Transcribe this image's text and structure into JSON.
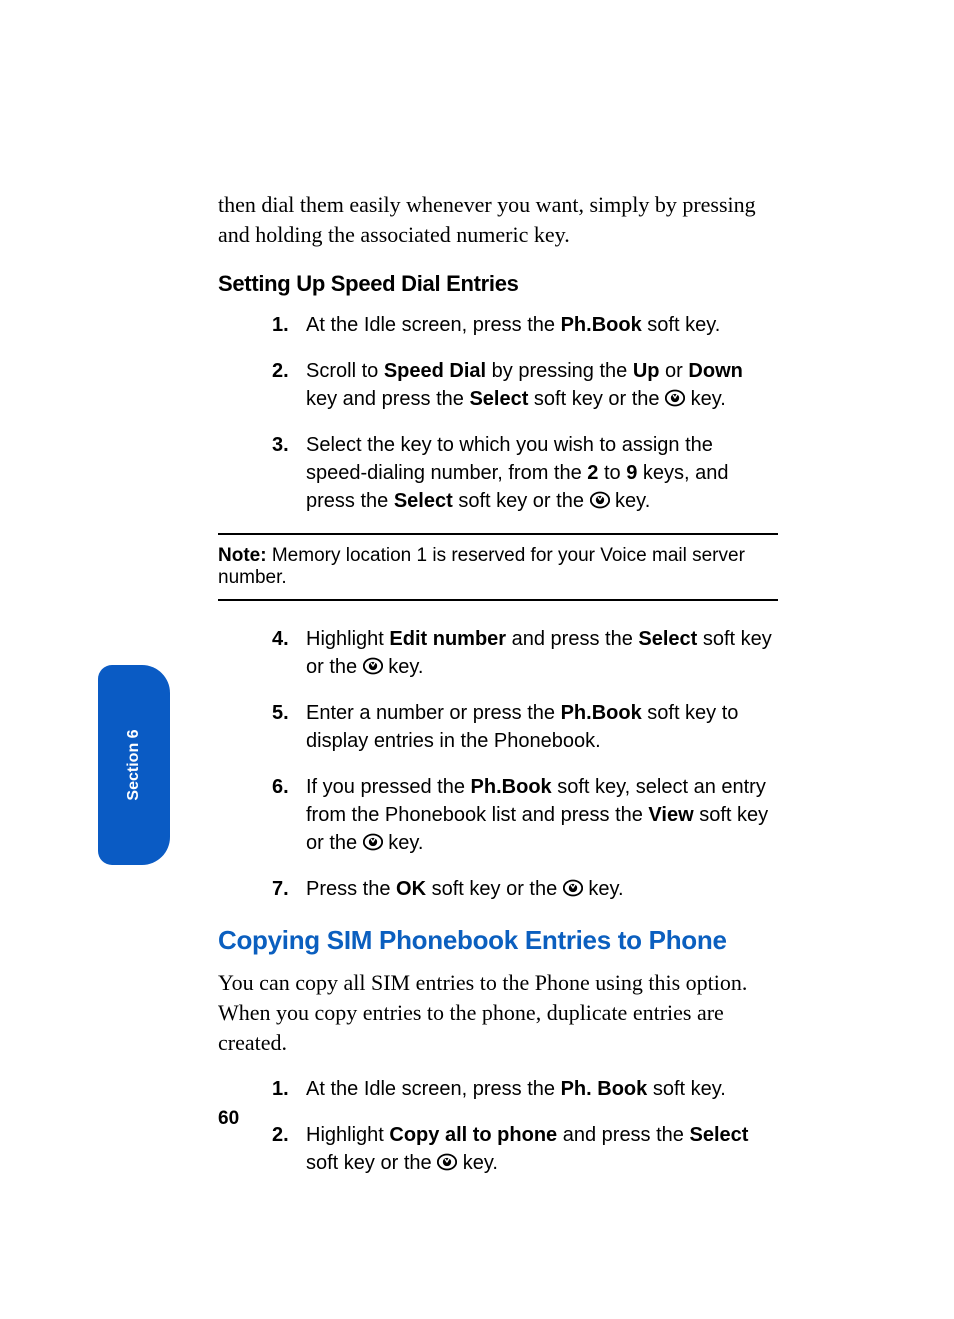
{
  "tab": {
    "label": "Section 6"
  },
  "page_number": "60",
  "intro": "then dial them easily whenever you want, simply by pressing and holding the associated numeric key.",
  "section_a": {
    "heading": "Setting Up Speed Dial Entries",
    "steps_first": [
      {
        "num": "1.",
        "parts": [
          {
            "t": "At the Idle screen, press the "
          },
          {
            "t": "Ph.Book",
            "b": true
          },
          {
            "t": " soft key."
          }
        ]
      },
      {
        "num": "2.",
        "parts": [
          {
            "t": "Scroll to "
          },
          {
            "t": "Speed Dial",
            "b": true
          },
          {
            "t": " by pressing the "
          },
          {
            "t": "Up",
            "b": true
          },
          {
            "t": " or "
          },
          {
            "t": "Down",
            "b": true
          },
          {
            "t": " key and press the "
          },
          {
            "t": "Select",
            "b": true
          },
          {
            "t": " soft key or the "
          },
          {
            "icon": true
          },
          {
            "t": " key."
          }
        ]
      },
      {
        "num": "3.",
        "parts": [
          {
            "t": "Select the key to which you wish to assign the speed-dialing number, from the "
          },
          {
            "t": "2",
            "b": true
          },
          {
            "t": " to "
          },
          {
            "t": "9",
            "b": true
          },
          {
            "t": " keys, and press the "
          },
          {
            "t": "Select",
            "b": true
          },
          {
            "t": " soft key or the "
          },
          {
            "icon": true
          },
          {
            "t": " key."
          }
        ]
      }
    ],
    "note_label": "Note:",
    "note_text": " Memory location 1 is reserved for your Voice mail server number.",
    "steps_second": [
      {
        "num": "4.",
        "parts": [
          {
            "t": "Highlight "
          },
          {
            "t": "Edit number",
            "b": true
          },
          {
            "t": " and press the "
          },
          {
            "t": "Select",
            "b": true
          },
          {
            "t": " soft key or the "
          },
          {
            "icon": true
          },
          {
            "t": " key."
          }
        ]
      },
      {
        "num": "5.",
        "parts": [
          {
            "t": "Enter a number or press the "
          },
          {
            "t": "Ph.Book",
            "b": true
          },
          {
            "t": " soft key to display entries in the Phonebook."
          }
        ]
      },
      {
        "num": "6.",
        "parts": [
          {
            "t": "If you pressed the "
          },
          {
            "t": "Ph.Book",
            "b": true
          },
          {
            "t": " soft key, select an entry from the Phonebook list and press the "
          },
          {
            "t": "View",
            "b": true
          },
          {
            "t": " soft key or the "
          },
          {
            "icon": true
          },
          {
            "t": " key."
          }
        ]
      },
      {
        "num": "7.",
        "parts": [
          {
            "t": "Press the "
          },
          {
            "t": "OK",
            "b": true
          },
          {
            "t": " soft key or the "
          },
          {
            "icon": true
          },
          {
            "t": " key."
          }
        ]
      }
    ]
  },
  "section_b": {
    "heading": "Copying SIM Phonebook Entries to Phone",
    "intro": "You can copy all SIM entries to the Phone using this option. When you copy entries to the phone, duplicate entries are created.",
    "steps": [
      {
        "num": "1.",
        "parts": [
          {
            "t": "At the Idle screen, press the "
          },
          {
            "t": "Ph. Book",
            "b": true
          },
          {
            "t": " soft key."
          }
        ]
      },
      {
        "num": "2.",
        "parts": [
          {
            "t": "Highlight "
          },
          {
            "t": "Copy all to phone",
            "b": true
          },
          {
            "t": " and press the "
          },
          {
            "t": "Select",
            "b": true
          },
          {
            "t": " soft key or the "
          },
          {
            "icon": true
          },
          {
            "t": " key."
          }
        ]
      }
    ]
  }
}
